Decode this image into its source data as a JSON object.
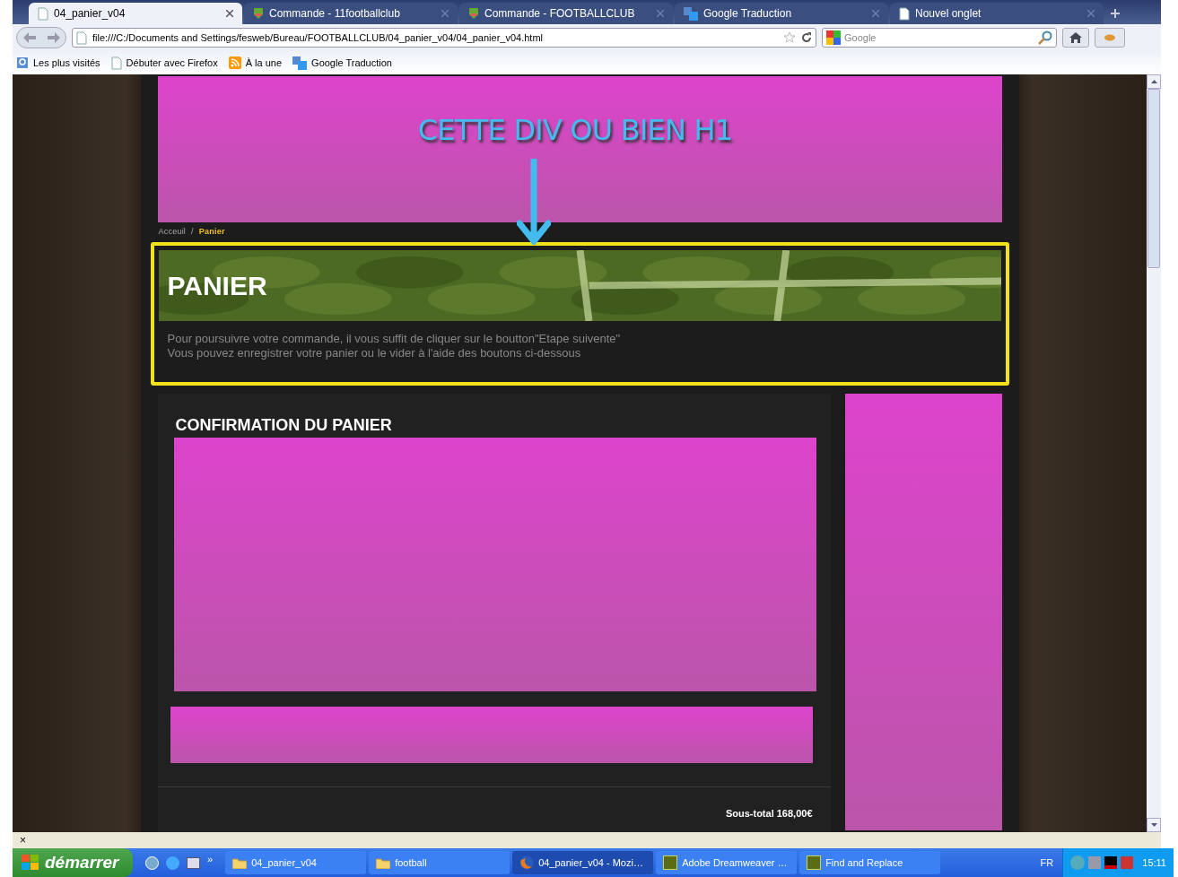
{
  "tabs": [
    {
      "label": "04_panier_v04",
      "selected": true,
      "kind": "page"
    },
    {
      "label": "Commande - 11footballclub",
      "selected": false,
      "kind": "site"
    },
    {
      "label": "Commande - FOOTBALLCLUB",
      "selected": false,
      "kind": "site"
    },
    {
      "label": "Google Traduction",
      "selected": false,
      "kind": "translate"
    },
    {
      "label": "Nouvel onglet",
      "selected": false,
      "kind": "page"
    }
  ],
  "address": "file:///C:/Documents and Settings/fesweb/Bureau/FOOTBALLCLUB/04_panier_v04/04_panier_v04.html",
  "search": {
    "placeholder": "Google"
  },
  "bookmarks": [
    {
      "label": "Les plus visités",
      "kind": "search"
    },
    {
      "label": "Débuter avec Firefox",
      "kind": "page"
    },
    {
      "label": "À la une",
      "kind": "feed"
    },
    {
      "label": "Google Traduction",
      "kind": "translate"
    }
  ],
  "page": {
    "annotation": "CETTE DIV OU BIEN H1",
    "breadcrumb": [
      {
        "label": "Acceuil",
        "selected": false
      },
      {
        "label": "/",
        "selected": false
      },
      {
        "label": "Panier",
        "selected": true
      }
    ],
    "banner_title": "PANIER",
    "intro": [
      "Pour poursuivre votre commande, il vous suffit de cliquer sur le boutton\"Etape suivente\"",
      "Vous pouvez enregistrer votre panier ou le vider à l'aide des boutons ci-dessous"
    ],
    "section_title": "CONFIRMATION DU PANIER",
    "subtotal": "Sous-total 168,00€"
  },
  "findbar": {
    "close": "×"
  },
  "taskbar": {
    "start": "démarrer",
    "quicklaunch_more": "»",
    "items": [
      {
        "label": "04_panier_v04",
        "selected": false,
        "kind": "folder"
      },
      {
        "label": "football",
        "selected": false,
        "kind": "folder"
      },
      {
        "label": "04_panier_v04 - Mozi…",
        "selected": true,
        "kind": "firefox"
      },
      {
        "label": "Adobe Dreamweaver …",
        "selected": false,
        "kind": "dw"
      },
      {
        "label": "Find and Replace",
        "selected": false,
        "kind": "dw"
      }
    ],
    "language": "FR",
    "time": "15:11"
  }
}
